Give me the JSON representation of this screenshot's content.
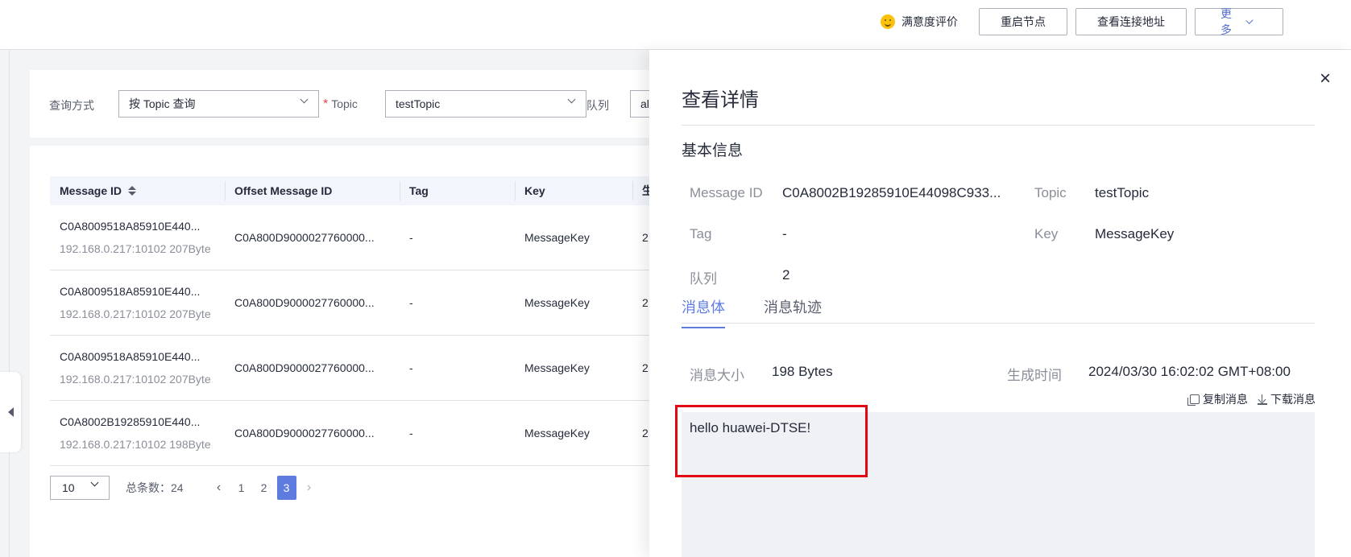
{
  "topbar": {
    "rating_label": "满意度评价",
    "restart_button": "重启节点",
    "view_address_button": "查看连接地址",
    "more_button": "更多"
  },
  "filter": {
    "query_mode_label": "查询方式",
    "query_mode_value": "按 Topic 查询",
    "topic_label": "Topic",
    "topic_value": "testTopic",
    "queue_label": "队列",
    "queue_value": "al"
  },
  "table": {
    "columns": [
      "Message ID",
      "Offset Message ID",
      "Tag",
      "Key",
      "生"
    ],
    "rows": [
      {
        "id": "C0A8009518A85910E440...",
        "sub": "192.168.0.217:10102 207Byte",
        "offset": "C0A800D9000027760000...",
        "tag": "-",
        "key": "MessageKey",
        "time": "2"
      },
      {
        "id": "C0A8009518A85910E440...",
        "sub": "192.168.0.217:10102 207Byte",
        "offset": "C0A800D9000027760000...",
        "tag": "-",
        "key": "MessageKey",
        "time": "2"
      },
      {
        "id": "C0A8009518A85910E440...",
        "sub": "192.168.0.217:10102 207Byte",
        "offset": "C0A800D9000027760000...",
        "tag": "-",
        "key": "MessageKey",
        "time": "2"
      },
      {
        "id": "C0A8002B19285910E440...",
        "sub": "192.168.0.217:10102 198Byte",
        "offset": "C0A800D9000027760000...",
        "tag": "-",
        "key": "MessageKey",
        "time": "2"
      }
    ]
  },
  "pager": {
    "page_size": "10",
    "total": "总条数：24",
    "pages": [
      "1",
      "2",
      "3"
    ],
    "current": "3"
  },
  "drawer": {
    "title": "查看详情",
    "section": "基本信息",
    "message_id_label": "Message ID",
    "message_id_value": "C0A8002B19285910E44098C933...",
    "topic_label": "Topic",
    "topic_value": "testTopic",
    "tag_label": "Tag",
    "tag_value": "-",
    "key_label": "Key",
    "key_value": "MessageKey",
    "queue_label": "队列",
    "queue_value": "2",
    "tabs": [
      "消息体",
      "消息轨迹"
    ],
    "size_label": "消息大小",
    "size_value": "198 Bytes",
    "time_label": "生成时间",
    "time_value": "2024/03/30 16:02:02 GMT+08:00",
    "copy_label": "复制消息",
    "download_label": "下载消息",
    "message_body": "hello huawei-DTSE!"
  }
}
